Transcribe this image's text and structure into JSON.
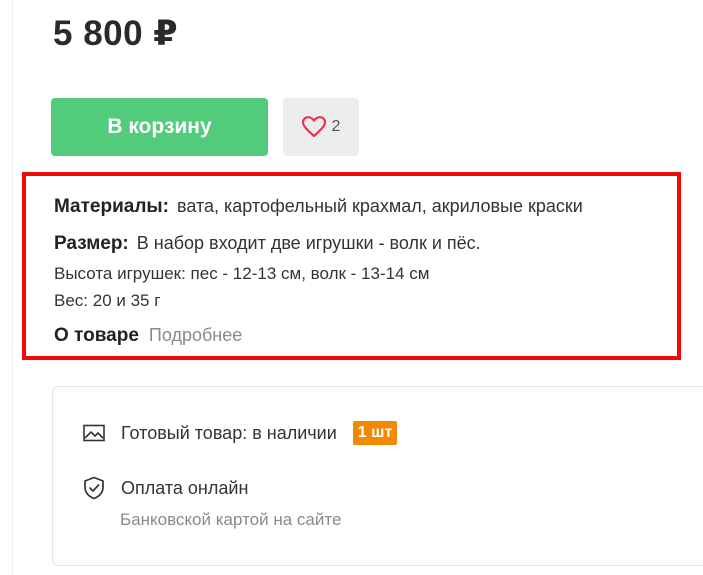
{
  "product": {
    "price": "5 800 ₽",
    "cart_button": "В корзину",
    "favorites_count": "2"
  },
  "details": {
    "materials_label": "Материалы:",
    "materials_value": "вата, картофельный крахмал, акриловые краски",
    "size_label": "Размер:",
    "size_value": "В набор входит две игрушки - волк и пёс.",
    "height_line": "Высота игрушек: пес - 12-13 см, волк - 13-14 см",
    "weight_line": "Вес: 20 и 35 г",
    "about_label": "О товаре",
    "more_link": "Подробнее"
  },
  "delivery": {
    "stock_text": "Готовый товар: в наличии",
    "stock_badge": "1 шт",
    "payment_title": "Оплата онлайн",
    "payment_sub": "Банковской картой на сайте"
  },
  "colors": {
    "accent_green": "#52cc7a",
    "highlight_red": "#f00a0a",
    "badge_orange": "#f08a00",
    "heart_red": "#e8334a"
  },
  "icons": [
    "heart-icon",
    "image-icon",
    "shield-check-icon"
  ]
}
